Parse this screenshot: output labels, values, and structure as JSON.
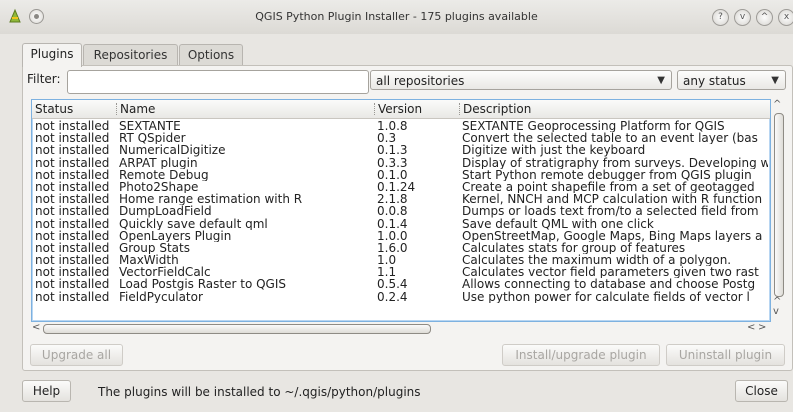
{
  "window": {
    "title": "QGIS Python Plugin Installer - 175 plugins available",
    "controls": [
      "?",
      "v",
      "^",
      "x"
    ]
  },
  "tabs": [
    {
      "label": "Plugins",
      "active": true
    },
    {
      "label": "Repositories",
      "active": false
    },
    {
      "label": "Options",
      "active": false
    }
  ],
  "filter": {
    "label": "Filter:",
    "value": "",
    "repository_select": "all repositories",
    "status_select": "any status"
  },
  "table": {
    "headers": {
      "status": "Status",
      "name": "Name",
      "version": "Version",
      "description": "Description"
    },
    "rows": [
      {
        "status": "not installed",
        "name": "SEXTANTE",
        "version": "1.0.8",
        "description": "SEXTANTE Geoprocessing Platform for QGIS"
      },
      {
        "status": "not installed",
        "name": "RT QSpider",
        "version": "0.3",
        "description": "Convert the selected table to an event layer (bas"
      },
      {
        "status": "not installed",
        "name": "NumericalDigitize",
        "version": "0.1.3",
        "description": "Digitize with just the keyboard"
      },
      {
        "status": "not installed",
        "name": "ARPAT plugin",
        "version": "0.3.3",
        "description": "Display of stratigraphy from surveys. Developing w"
      },
      {
        "status": "not installed",
        "name": "Remote Debug",
        "version": "0.1.0",
        "description": "Start Python remote debugger from QGIS plugin"
      },
      {
        "status": "not installed",
        "name": "Photo2Shape",
        "version": "0.1.24",
        "description": "Create a point shapefile from a set of geotagged"
      },
      {
        "status": "not installed",
        "name": "Home range estimation with R",
        "version": "2.1.8",
        "description": "Kernel, NNCH and MCP calculation with R function"
      },
      {
        "status": "not installed",
        "name": "DumpLoadField",
        "version": "0.0.8",
        "description": "Dumps or loads text from/to a selected field from"
      },
      {
        "status": "not installed",
        "name": "Quickly save default qml",
        "version": "0.1.4",
        "description": "Save default QML with one click"
      },
      {
        "status": "not installed",
        "name": "OpenLayers Plugin",
        "version": "1.0.0",
        "description": "OpenStreetMap, Google Maps, Bing Maps layers a"
      },
      {
        "status": "not installed",
        "name": "Group Stats",
        "version": "1.6.0",
        "description": "Calculates stats for group of features"
      },
      {
        "status": "not installed",
        "name": "MaxWidth",
        "version": "1.0",
        "description": "Calculates the maximum width of a polygon."
      },
      {
        "status": "not installed",
        "name": "VectorFieldCalc",
        "version": "1.1",
        "description": "Calculates vector field parameters given two rast"
      },
      {
        "status": "not installed",
        "name": "Load Postgis Raster to QGIS",
        "version": "0.5.4",
        "description": "Allows connecting to database and choose Postg"
      },
      {
        "status": "not installed",
        "name": "FieldPyculator",
        "version": "0.2.4",
        "description": "Use python power for calculate fields of vector l"
      }
    ]
  },
  "buttons": {
    "upgrade_all": "Upgrade all",
    "install_upgrade": "Install/upgrade plugin",
    "uninstall": "Uninstall plugin",
    "help": "Help",
    "close": "Close"
  },
  "footer": {
    "message": "The plugins will be installed to ~/.qgis/python/plugins"
  }
}
